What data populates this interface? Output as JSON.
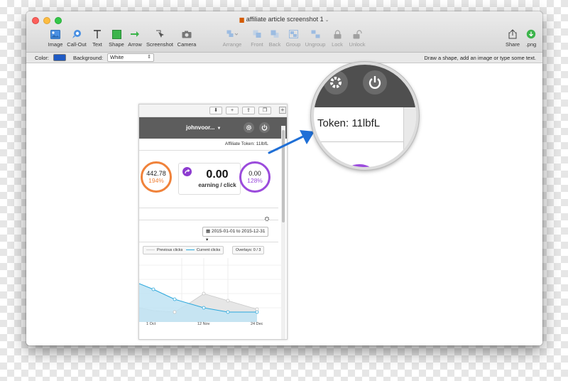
{
  "window": {
    "title": "affiliate article screenshot 1",
    "toolbar": {
      "left_tools": [
        {
          "label": "Image",
          "icon": "image-icon"
        },
        {
          "label": "Call-Out",
          "icon": "callout-icon"
        },
        {
          "label": "Text",
          "icon": "text-icon"
        },
        {
          "label": "Shape",
          "icon": "shape-icon"
        },
        {
          "label": "Arrow",
          "icon": "arrow-icon"
        },
        {
          "label": "Screenshot",
          "icon": "screenshot-icon"
        },
        {
          "label": "Camera",
          "icon": "camera-icon"
        }
      ],
      "arrange_tools": [
        {
          "label": "Arrange",
          "icon": "arrange-icon"
        },
        {
          "label": "Front",
          "icon": "front-icon"
        },
        {
          "label": "Back",
          "icon": "back-icon"
        },
        {
          "label": "Group",
          "icon": "group-icon"
        },
        {
          "label": "Ungroup",
          "icon": "ungroup-icon"
        },
        {
          "label": "Lock",
          "icon": "lock-icon"
        },
        {
          "label": "Unlock",
          "icon": "unlock-icon"
        }
      ],
      "right_tools": [
        {
          "label": "Share",
          "icon": "share-icon"
        },
        {
          "label": ".png",
          "icon": "png-export-icon"
        }
      ]
    },
    "options": {
      "color_label": "Color:",
      "color_value": "#1f5ac4",
      "background_label": "Background:",
      "background_value": "White",
      "hint": "Draw a shape, add an image or type some text."
    }
  },
  "embedded": {
    "username": "johnvoor...",
    "token_text": "Affiliate Token: 11lbfL",
    "stat_left": {
      "value": "442.78",
      "percent": "194%",
      "color": "#f0823a"
    },
    "earning": {
      "value": "0.00",
      "label": "earning / click"
    },
    "stat_right": {
      "value": "0.00",
      "percent": "128%",
      "color": "#9b4bdc"
    },
    "date_range": "2015-01-01 to 2015-12-31",
    "legend": {
      "previous": "Previous clicks",
      "current": "Current clicks",
      "overlays": "Overlays: 0 / 3"
    },
    "x_labels": [
      "1 Oct",
      "12 Nov",
      "24 Dec"
    ]
  },
  "magnifier": {
    "token_text": "Token: 11lbfL"
  },
  "colors": {
    "accent_blue": "#1f6fd6",
    "chart_current": "#2aa7dc",
    "chart_previous": "#cfcfcf"
  }
}
